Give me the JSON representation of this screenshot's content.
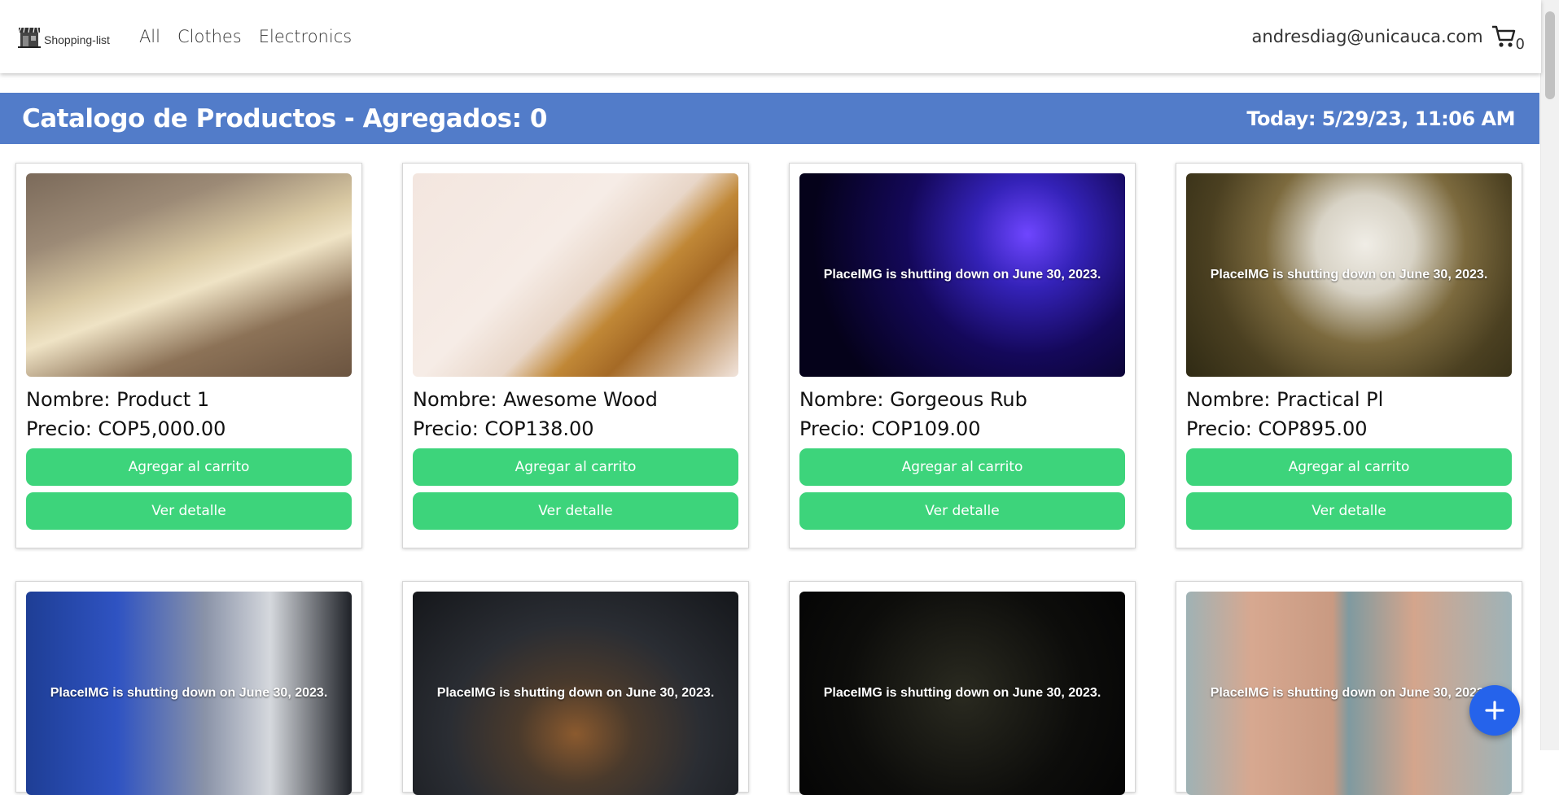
{
  "navbar": {
    "brand": "Shopping-list",
    "links": [
      "All",
      "Clothes",
      "Electronics"
    ],
    "user_email": "andresdiag@unicauca.com",
    "cart_count": "0"
  },
  "header": {
    "title": "Catalogo de Productos - Agregados: 0",
    "date": "Today: 5/29/23, 11:06 AM"
  },
  "products": [
    {
      "name": "Nombre: Product 1",
      "price": "Precio: COP5,000.00",
      "overlay": "",
      "add_label": "Agregar al carrito",
      "detail_label": "Ver detalle"
    },
    {
      "name": "Nombre: Awesome Wood",
      "price": "Precio: COP138.00",
      "overlay": "",
      "add_label": "Agregar al carrito",
      "detail_label": "Ver detalle"
    },
    {
      "name": "Nombre: Gorgeous Rub",
      "price": "Precio: COP109.00",
      "overlay": "PlaceIMG is shutting down on June 30, 2023.",
      "add_label": "Agregar al carrito",
      "detail_label": "Ver detalle"
    },
    {
      "name": "Nombre: Practical Pl",
      "price": "Precio: COP895.00",
      "overlay": "PlaceIMG is shutting down on June 30, 2023.",
      "add_label": "Agregar al carrito",
      "detail_label": "Ver detalle"
    },
    {
      "overlay": "PlaceIMG is shutting down on June 30, 2023."
    },
    {
      "overlay": "PlaceIMG is shutting down on June 30, 2023."
    },
    {
      "overlay": "PlaceIMG is shutting down on June 30, 2023."
    },
    {
      "overlay": "PlaceIMG is shutting down on June 30, 2023."
    }
  ],
  "fab": {
    "icon": "plus-icon"
  },
  "colors": {
    "header_bg": "#527cc9",
    "button_bg": "#3dd47b",
    "fab_bg": "#2563eb"
  }
}
